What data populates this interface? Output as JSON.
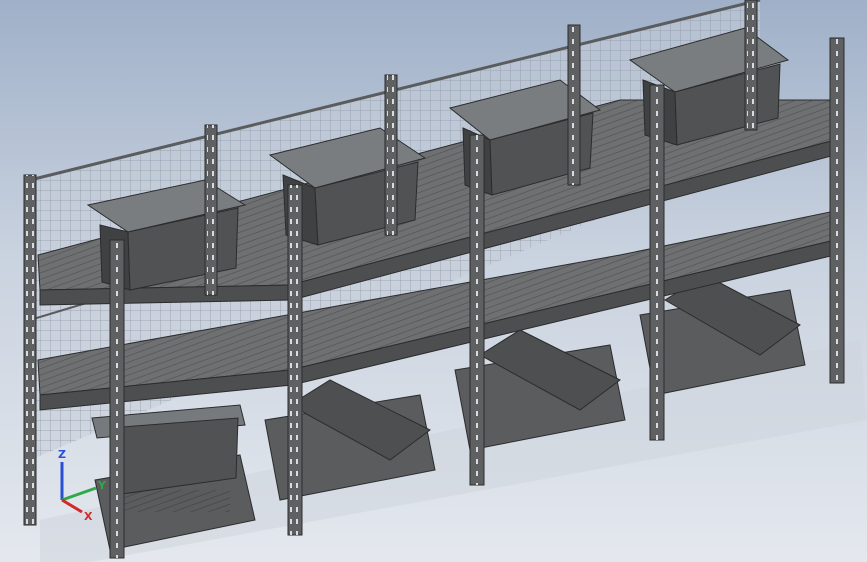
{
  "viewport": {
    "name": "cad-3d-viewport",
    "background_top": "#9fb0c8",
    "background_bottom": "#e4e8ee"
  },
  "model": {
    "description_icon": "rack-assembly-icon",
    "frame_color": "#5f6062",
    "deck_color": "#6e7072",
    "box_color": "#505254",
    "fixture_color": "#5a5c5e",
    "mesh_color": "#8f98a6",
    "bay_count": 4,
    "levels": 2
  },
  "triad": {
    "x_label": "X",
    "y_label": "Y",
    "z_label": "Z",
    "x_color": "#d22a2a",
    "y_color": "#2fa84a",
    "z_color": "#2a4fd2"
  }
}
